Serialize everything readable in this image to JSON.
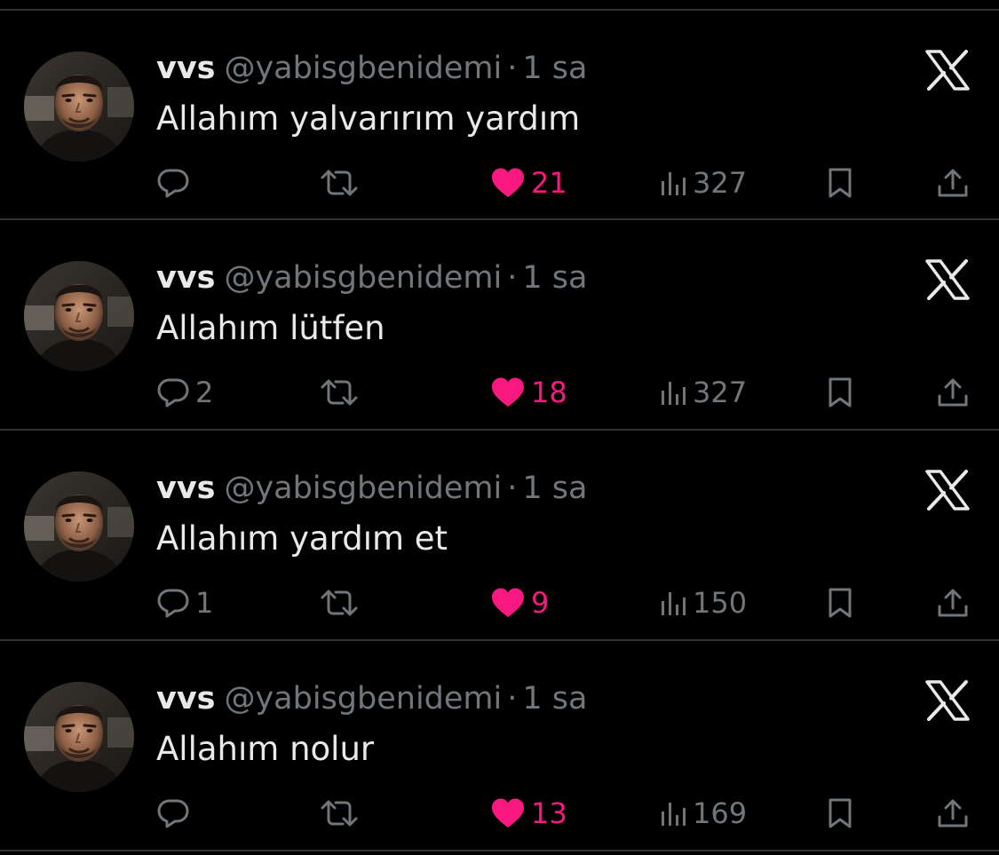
{
  "colors": {
    "background": "#000000",
    "text_primary": "#e7e9ea",
    "text_secondary": "#71767b",
    "like_pink": "#f91880",
    "divider": "#2f3336"
  },
  "icons": {
    "reply": "speech-bubble-icon",
    "retweet": "retweet-arrows-icon",
    "like": "heart-filled-icon",
    "views": "bar-chart-icon",
    "bookmark": "bookmark-icon",
    "share": "share-upload-icon",
    "brand": "x-logo-icon",
    "avatar": "profile-photo"
  },
  "tweets": [
    {
      "name": "vvs",
      "handle": "@yabisgbenidemi",
      "separator": "·",
      "time": "1 sa",
      "text": "Allahım yalvarırım yardım",
      "replies": "",
      "retweets": "",
      "likes": "21",
      "views": "327"
    },
    {
      "name": "vvs",
      "handle": "@yabisgbenidemi",
      "separator": "·",
      "time": "1 sa",
      "text": "Allahım lütfen",
      "replies": "2",
      "retweets": "",
      "likes": "18",
      "views": "327"
    },
    {
      "name": "vvs",
      "handle": "@yabisgbenidemi",
      "separator": "·",
      "time": "1 sa",
      "text": "Allahım yardım et",
      "replies": "1",
      "retweets": "",
      "likes": "9",
      "views": "150"
    },
    {
      "name": "vvs",
      "handle": "@yabisgbenidemi",
      "separator": "·",
      "time": "1 sa",
      "text": "Allahım nolur",
      "replies": "",
      "retweets": "",
      "likes": "13",
      "views": "169"
    }
  ]
}
